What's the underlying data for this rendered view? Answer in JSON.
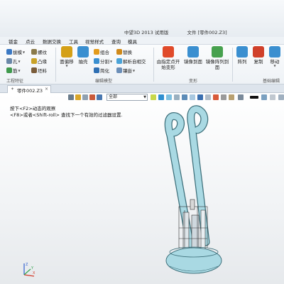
{
  "window": {
    "app_title": "中望3D 2013 试用版",
    "doc_title": "文件 [零件002.Z3]"
  },
  "menu": {
    "items": [
      "钣金",
      "点云",
      "数据交换",
      "工具",
      "视觉样式",
      "查询",
      "模具"
    ]
  },
  "ribbon": {
    "group1_items": [
      {
        "label": "拔模",
        "icon": "draft-icon",
        "color": "#3b79c4"
      },
      {
        "label": "孔",
        "icon": "hole-icon",
        "color": "#6a88a8"
      },
      {
        "label": "筋",
        "icon": "rib-icon",
        "color": "#3f9a4d"
      },
      {
        "label": "螺纹",
        "icon": "thread-icon",
        "color": "#8a7a4a"
      },
      {
        "label": "凸缘",
        "icon": "lip-icon",
        "color": "#c9a227"
      },
      {
        "label": "坯料",
        "icon": "stock-icon",
        "color": "#7a5c3a"
      }
    ],
    "group1_label": "工程特征",
    "group2_big": [
      {
        "label": "面偏移",
        "icon": "face-offset-icon",
        "color": "#d4a017"
      },
      {
        "label": "抽壳",
        "icon": "shell-icon",
        "color": "#3a8fd0"
      }
    ],
    "group2_small": [
      {
        "label": "组合",
        "icon": "combine-icon",
        "color": "#e39b1b"
      },
      {
        "label": "分割",
        "icon": "split-icon",
        "color": "#3a8fd0"
      },
      {
        "label": "简化",
        "icon": "simplify-icon",
        "color": "#2f6fb3"
      },
      {
        "label": "替换",
        "icon": "replace-icon",
        "color": "#d08a1a"
      },
      {
        "label": "解析自相交",
        "icon": "resolve-icon",
        "color": "#4aa3d8"
      },
      {
        "label": "镶嵌",
        "icon": "emboss-icon",
        "color": "#6c8fb8"
      }
    ],
    "group2_label": "编辑模型",
    "group3_big": [
      {
        "label": "由指定点开",
        "label2": "始变形",
        "icon": "deform-point-icon",
        "color": "#e04a2a"
      },
      {
        "label": "镜像到面",
        "icon": "mirror-face-icon",
        "color": "#3a8fd0"
      },
      {
        "label": "镜像阵列到",
        "label2": "面",
        "icon": "mirror-pattern-icon",
        "color": "#47a14e"
      }
    ],
    "group3_label": "变形",
    "group4_big": [
      {
        "label": "阵列",
        "icon": "pattern-icon",
        "color": "#3a8fd0"
      },
      {
        "label": "复制",
        "icon": "copy-icon",
        "color": "#d0402a"
      },
      {
        "label": "移动",
        "icon": "move-icon",
        "color": "#3a8fd0"
      }
    ],
    "group4_label": "基础编辑"
  },
  "doc_tab": {
    "label": "零件002.Z3",
    "close": "×",
    "pin": "✦"
  },
  "view_toolbar": {
    "filter_value": "全部"
  },
  "hints": {
    "line1": "按下<F2>动态的观察",
    "line2": "<F8>或者<Shift-roll> 查找下一个有效的过滤器设置."
  },
  "triad": {
    "x": "X",
    "y": "Y",
    "z": "Z"
  },
  "colors": {
    "model_body": "#a9d9e3",
    "model_edge": "#3d6f7a",
    "axis_x": "#d43a2a",
    "axis_y": "#2fa34a",
    "axis_z": "#2f5fd0"
  }
}
